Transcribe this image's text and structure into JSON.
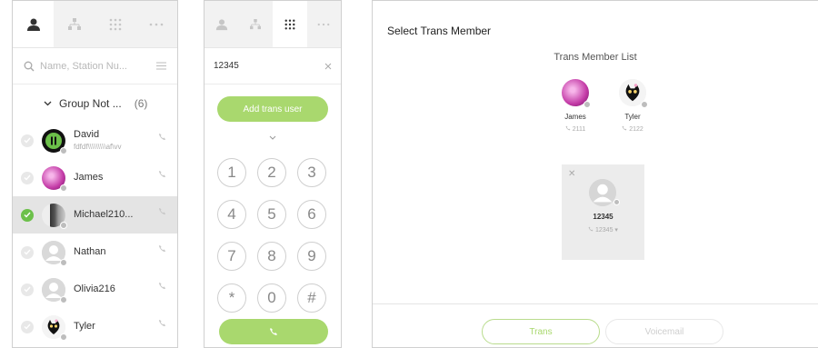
{
  "contacts_panel": {
    "tabs": [
      {
        "name": "contacts",
        "icon": "person-icon",
        "active": true
      },
      {
        "name": "org",
        "icon": "org-chart-icon",
        "active": false
      },
      {
        "name": "keypad",
        "icon": "keypad-icon",
        "active": false
      },
      {
        "name": "more",
        "icon": "more-icon",
        "active": false
      }
    ],
    "search_placeholder": "Name, Station Nu...",
    "group": {
      "label": "Group Not ...",
      "count": "(6)"
    },
    "contacts": [
      {
        "name": "David",
        "sub": "fdfdf\\\\\\\\\\\\\\\\\\af\\vv",
        "selected": false
      },
      {
        "name": "James",
        "sub": "",
        "selected": false
      },
      {
        "name": "Michael210...",
        "sub": "",
        "selected": true
      },
      {
        "name": "Nathan",
        "sub": "",
        "selected": false
      },
      {
        "name": "Olivia216",
        "sub": "",
        "selected": false
      },
      {
        "name": "Tyler",
        "sub": "",
        "selected": false
      }
    ]
  },
  "dialer_panel": {
    "input_value": "12345",
    "add_button": "Add trans user",
    "keys": [
      "1",
      "2",
      "3",
      "4",
      "5",
      "6",
      "7",
      "8",
      "9",
      "*",
      "0",
      "#"
    ]
  },
  "trans_panel": {
    "title": "Select Trans Member",
    "list_title": "Trans Member List",
    "members": [
      {
        "name": "James",
        "ext": "2111"
      },
      {
        "name": "Tyler",
        "ext": "2122"
      }
    ],
    "selected_member": {
      "name": "12345",
      "ext": "12345"
    },
    "trans_button": "Trans",
    "voicemail_button": "Voicemail"
  },
  "colors": {
    "accent": "#a9d86e",
    "check_on": "#6cc04a"
  }
}
